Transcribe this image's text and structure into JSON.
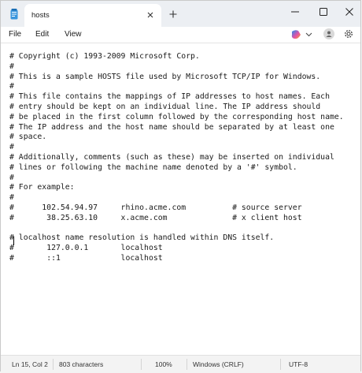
{
  "tab": {
    "title": "hosts"
  },
  "menu": {
    "file": "File",
    "edit": "Edit",
    "view": "View"
  },
  "editor": {
    "content": "# Copyright (c) 1993-2009 Microsoft Corp.\n#\n# This is a sample HOSTS file used by Microsoft TCP/IP for Windows.\n#\n# This file contains the mappings of IP addresses to host names. Each\n# entry should be kept on an individual line. The IP address should\n# be placed in the first column followed by the corresponding host name.\n# The IP address and the host name should be separated by at least one\n# space.\n#\n# Additionally, comments (such as these) may be inserted on individual\n# lines or following the machine name denoted by a '#' symbol.\n#\n# For example:\n#\n#      102.54.94.97     rhino.acme.com          # source server\n#       38.25.63.10     x.acme.com              # x client host\n\n# localhost name resolution is handled within DNS itself.\n#\t127.0.0.1       localhost\n#\t::1             localhost"
  },
  "status": {
    "position": "Ln 15, Col 2",
    "characters": "803 characters",
    "zoom": "100%",
    "line_ending": "Windows (CRLF)",
    "encoding": "UTF-8"
  },
  "icons": {
    "app": "notepad-icon",
    "close_tab": "close-icon",
    "new_tab": "plus-icon",
    "minimize": "minimize-icon",
    "maximize": "maximize-icon",
    "close_window": "close-icon",
    "copilot": "copilot-icon",
    "account": "avatar",
    "settings": "gear-icon"
  },
  "colors": {
    "accent_notepad": "#3a96dd",
    "copilot_gradient": [
      "#1f8ef1",
      "#e352a8",
      "#f7a721"
    ]
  }
}
